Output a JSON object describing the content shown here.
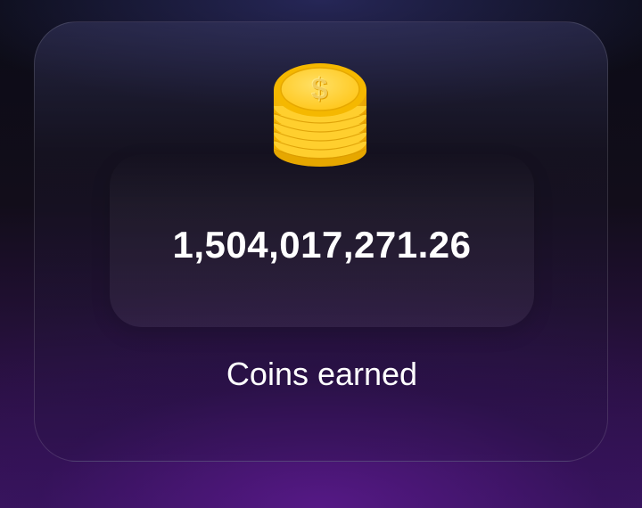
{
  "stats_card": {
    "icon": "coin-stack-icon",
    "amount": "1,504,017,271.26",
    "caption": "Coins earned"
  },
  "colors": {
    "coin_gold": "#ffd23a",
    "coin_shadow": "#e0a800",
    "text": "#ffffff",
    "background_purple": "#3b1660"
  }
}
